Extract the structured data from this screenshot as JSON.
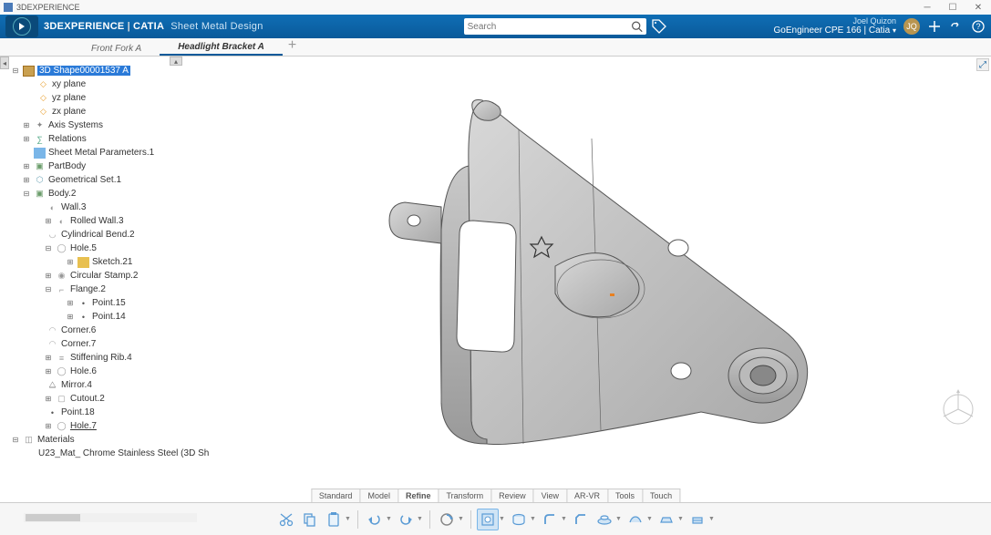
{
  "window": {
    "title": "3DEXPERIENCE"
  },
  "topbar": {
    "brand": "3DEXPERIENCE",
    "product": "CATIA",
    "module": "Sheet Metal Design",
    "search_placeholder": "Search",
    "user_name": "Joel Quizon",
    "user_context": "GoEngineer CPE 166 | Catia",
    "avatar_initials": "JQ"
  },
  "tabs": [
    {
      "label": "Front Fork A",
      "active": false
    },
    {
      "label": "Headlight Bracket A",
      "active": true
    }
  ],
  "tree": {
    "root": "3D Shape00001537 A",
    "planes": [
      "xy plane",
      "yz plane",
      "zx plane"
    ],
    "nodes": [
      "Axis Systems",
      "Relations",
      "Sheet Metal Parameters.1",
      "PartBody",
      "Geometrical Set.1"
    ],
    "body2": {
      "label": "Body.2",
      "children": [
        "Wall.3",
        "Rolled Wall.3",
        "Cylindrical Bend.2"
      ],
      "hole5": {
        "label": "Hole.5",
        "sketch": "Sketch.21"
      },
      "circular_stamp": "Circular Stamp.2",
      "flange2": {
        "label": "Flange.2",
        "points": [
          "Point.15",
          "Point.14"
        ]
      },
      "corners": [
        "Corner.6",
        "Corner.7"
      ],
      "rest": [
        "Stiffening Rib.4",
        "Hole.6",
        "Mirror.4",
        "Cutout.2",
        "Point.18",
        "Hole.7"
      ]
    },
    "materials": {
      "label": "Materials",
      "item": "U23_Mat_ Chrome Stainless Steel (3D Sh"
    }
  },
  "bottom_tabs": [
    "Standard",
    "Model",
    "Refine",
    "Transform",
    "Review",
    "View",
    "AR-VR",
    "Tools",
    "Touch"
  ],
  "bottom_active": "Refine"
}
